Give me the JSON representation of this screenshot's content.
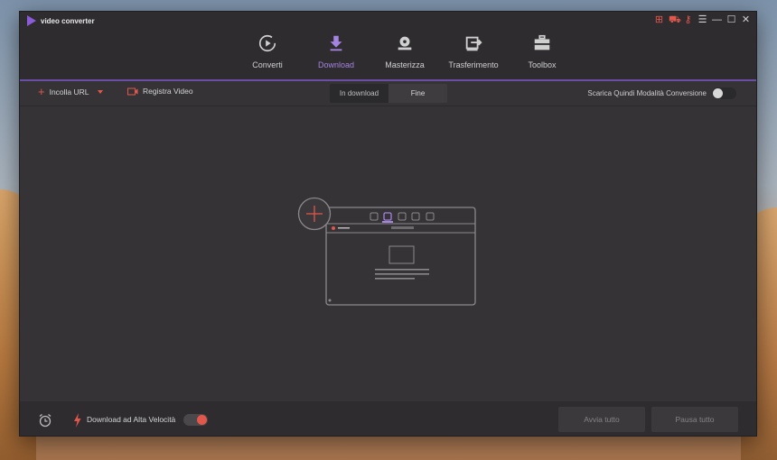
{
  "app": {
    "title": "video converter"
  },
  "window_controls": [
    {
      "name": "gift-icon",
      "glyph": "⊞"
    },
    {
      "name": "cart-icon",
      "glyph": "⛟"
    },
    {
      "name": "key-icon",
      "glyph": "⚷"
    },
    {
      "name": "menu-icon",
      "glyph": "☰"
    },
    {
      "name": "minimize-icon",
      "glyph": "—"
    },
    {
      "name": "maximize-icon",
      "glyph": "☐"
    },
    {
      "name": "close-icon",
      "glyph": "✕"
    }
  ],
  "nav": {
    "items": [
      {
        "label": "Converti",
        "icon": "convert-icon"
      },
      {
        "label": "Download",
        "icon": "download-icon"
      },
      {
        "label": "Masterizza",
        "icon": "burn-icon"
      },
      {
        "label": "Trasferimento",
        "icon": "transfer-icon"
      },
      {
        "label": "Toolbox",
        "icon": "toolbox-icon"
      }
    ],
    "active": "Download"
  },
  "toolbar": {
    "paste_url": "Incolla URL",
    "record_video": "Registra Video",
    "tabs": [
      "In download",
      "Fine"
    ],
    "active_tab": "In download",
    "convert_mode_label": "Scarica Quindi Modalità Conversione",
    "convert_mode_on": false
  },
  "footer": {
    "high_speed_label": "Download ad Alta Velocità",
    "high_speed_on": true,
    "start_all": "Avvia tutto",
    "pause_all": "Pausa tutto"
  },
  "colors": {
    "accent": "#a583e0",
    "red": "#e2574c",
    "window_bg": "#353336",
    "bar_bg": "#2e2c2f"
  }
}
